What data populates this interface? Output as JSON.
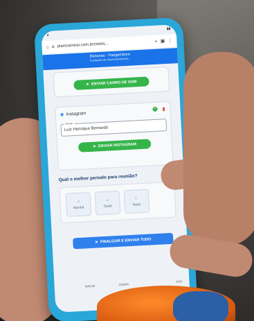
{
  "browser": {
    "url": "planisamear.com.br/redes...",
    "tab_icon": "plus-icon"
  },
  "header": {
    "title": "Bananas - Pangamboro",
    "subtitle": "Fundação de Desenvolvimento..."
  },
  "whatsapp_card": {
    "button_label": "ENVIAR CARRO DE SOM"
  },
  "instagram": {
    "title": "Instagram",
    "field_label": "Nome",
    "field_value": "Luiz Henrique Bernardo",
    "button_label": "ENVIAR INSTAGRAM"
  },
  "question": "Qual o melhor período para reunião?",
  "periods": [
    {
      "label": "Manhã",
      "icon": "sun-icon"
    },
    {
      "label": "Tarde",
      "icon": "sunset-icon"
    },
    {
      "label": "Noite",
      "icon": "moon-icon"
    }
  ],
  "finish_button": "FINALIZAR E ENVIAR TUDO",
  "footer_logos": [
    "",
    "MACAÉ",
    "CNEMA",
    "",
    "GOV"
  ],
  "colors": {
    "green": "#35b44a",
    "blue": "#2f80ed",
    "phone_case": "#2aa6d8"
  }
}
